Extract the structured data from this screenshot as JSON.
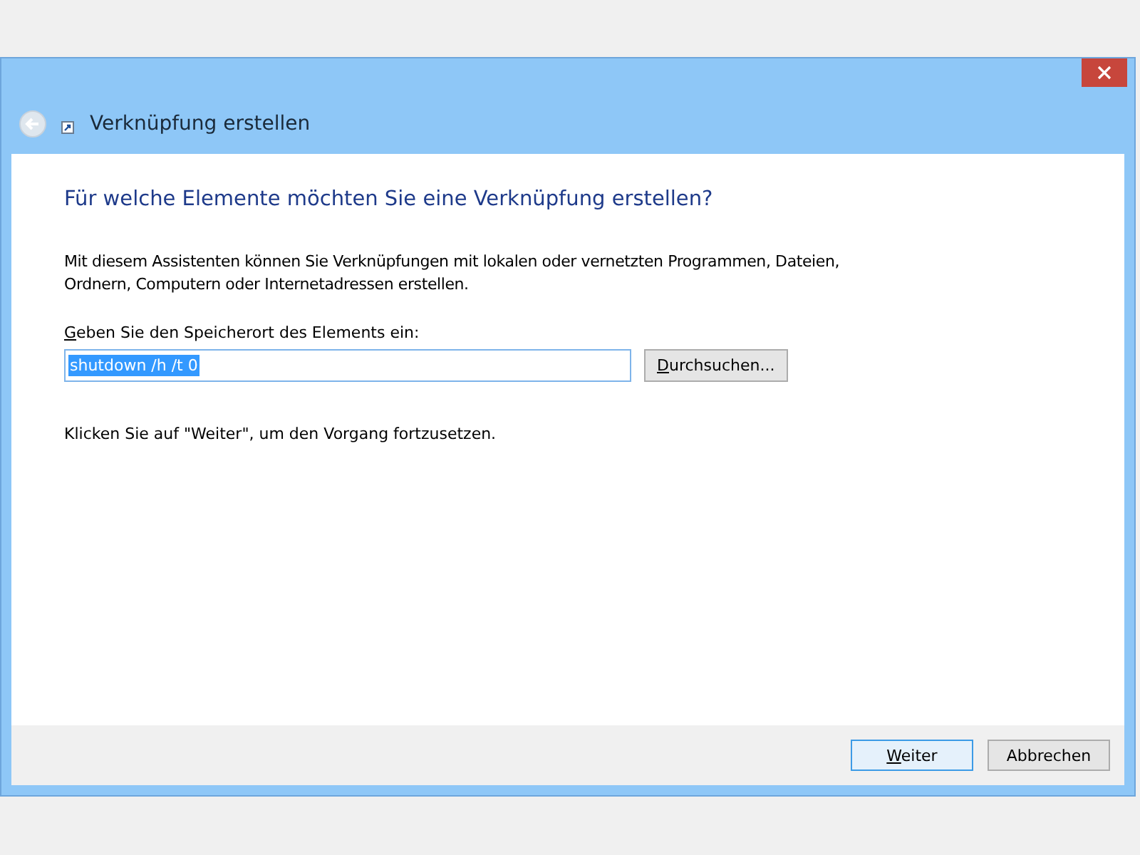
{
  "window": {
    "title": "Verknüpfung erstellen"
  },
  "heading": "Für welche Elemente möchten Sie eine Verknüpfung erstellen?",
  "description": "Mit diesem Assistenten können Sie Verknüpfungen mit lokalen oder vernetzten Programmen, Dateien, Ordnern, Computern oder Internetadressen erstellen.",
  "location": {
    "label": "Geben Sie den Speicherort des Elements ein:",
    "mnemonic_first": true,
    "value": "shutdown /h /t 0",
    "selected": true
  },
  "browse_button": {
    "label": "Durchsuchen...",
    "mnemonic_first": true
  },
  "hint": "Klicken Sie auf \"Weiter\", um den Vorgang fortzusetzen.",
  "buttons": [
    {
      "label": "Weiter",
      "mnemonic_first": true,
      "default": true
    },
    {
      "label": "Abbrechen",
      "mnemonic_first": false,
      "default": false
    }
  ]
}
